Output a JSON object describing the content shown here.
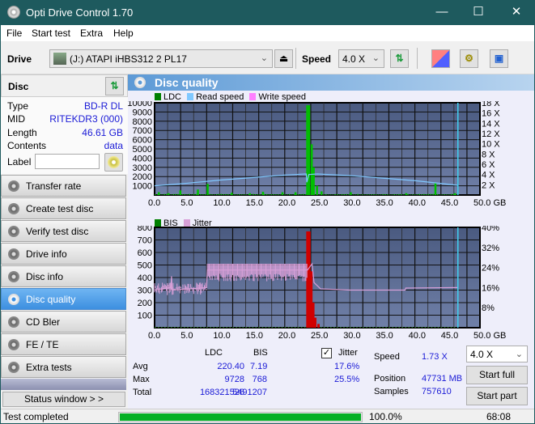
{
  "window": {
    "title": "Opti Drive Control 1.70",
    "minimize": "—",
    "maximize": "☐",
    "close": "✕"
  },
  "menu": [
    "File",
    "Start test",
    "Extra",
    "Help"
  ],
  "toolbar": {
    "drive_label": "Drive",
    "drive_value": "(J:)  ATAPI iHBS312   2 PL17",
    "eject": "⏏",
    "speed_label": "Speed",
    "speed_value": "4.0 X",
    "chevron": "⌄"
  },
  "disc": {
    "title": "Disc",
    "rows": [
      {
        "k": "Type",
        "v": "BD-R DL"
      },
      {
        "k": "MID",
        "v": "RITEKDR3 (000)"
      },
      {
        "k": "Length",
        "v": "46.61 GB"
      },
      {
        "k": "Contents",
        "v": "data"
      }
    ],
    "label_key": "Label",
    "label_value": ""
  },
  "nav": [
    {
      "label": "Transfer rate",
      "active": false
    },
    {
      "label": "Create test disc",
      "active": false
    },
    {
      "label": "Verify test disc",
      "active": false
    },
    {
      "label": "Drive info",
      "active": false
    },
    {
      "label": "Disc info",
      "active": false
    },
    {
      "label": "Disc quality",
      "active": true
    },
    {
      "label": "CD Bler",
      "active": false
    },
    {
      "label": "FE / TE",
      "active": false
    },
    {
      "label": "Extra tests",
      "active": false
    }
  ],
  "status_window": "Status window > >",
  "panel": {
    "title": "Disc quality"
  },
  "chart_data": [
    {
      "type": "bar",
      "title": "LDC / Read speed",
      "legend": [
        "LDC",
        "Read speed",
        "Write speed"
      ],
      "legend_colors": {
        "LDC": "#00c000",
        "Read speed": "#80c8ff",
        "Write speed": "#ff80ff"
      },
      "xlabel": "GB",
      "xlim": [
        0,
        50
      ],
      "x_ticks": [
        "0.0",
        "5.0",
        "10.0",
        "15.0",
        "20.0",
        "25.0",
        "30.0",
        "35.0",
        "40.0",
        "45.0",
        "50.0 GB"
      ],
      "ylim": [
        0,
        10000
      ],
      "y_ticks": [
        "1000",
        "2000",
        "3000",
        "4000",
        "5000",
        "6000",
        "7000",
        "8000",
        "9000",
        "10000"
      ],
      "y2lim": [
        0,
        18
      ],
      "y2_ticks": [
        "2 X",
        "4 X",
        "6 X",
        "8 X",
        "10 X",
        "12 X",
        "14 X",
        "16 X",
        "18 X"
      ],
      "ldc_spikes": [
        [
          0.5,
          300
        ],
        [
          2.0,
          200
        ],
        [
          3.8,
          500
        ],
        [
          6.5,
          600
        ],
        [
          8.0,
          1200
        ],
        [
          11.7,
          250
        ],
        [
          14.5,
          200
        ],
        [
          16.5,
          350
        ],
        [
          19.5,
          300
        ],
        [
          21.5,
          300
        ],
        [
          23.3,
          9728
        ],
        [
          23.6,
          9728
        ],
        [
          24.0,
          5500
        ],
        [
          24.3,
          3000
        ],
        [
          24.8,
          1000
        ],
        [
          25.5,
          400
        ],
        [
          30.0,
          300
        ],
        [
          38.5,
          200
        ],
        [
          43.0,
          1300
        ],
        [
          46.0,
          200
        ]
      ],
      "read_speed": [
        [
          0,
          1.8
        ],
        [
          5,
          2.3
        ],
        [
          10,
          2.9
        ],
        [
          15,
          3.4
        ],
        [
          20,
          3.9
        ],
        [
          23.3,
          4.1
        ],
        [
          23.4,
          2.5
        ],
        [
          23.7,
          4.0
        ],
        [
          25,
          4.1
        ],
        [
          30,
          3.8
        ],
        [
          35,
          3.3
        ],
        [
          40,
          2.8
        ],
        [
          46.6,
          1.9
        ]
      ],
      "end_marker_gb": 46.61
    },
    {
      "type": "bar",
      "title": "BIS / Jitter",
      "legend": [
        "BIS",
        "Jitter"
      ],
      "legend_colors": {
        "BIS": "#00c000",
        "Jitter": "#d8a0d8"
      },
      "xlabel": "GB",
      "xlim": [
        0,
        50
      ],
      "x_ticks": [
        "0.0",
        "5.0",
        "10.0",
        "15.0",
        "20.0",
        "25.0",
        "30.0",
        "35.0",
        "40.0",
        "45.0",
        "50.0 GB"
      ],
      "ylim": [
        0,
        800
      ],
      "y_ticks": [
        "100",
        "200",
        "300",
        "400",
        "500",
        "600",
        "700",
        "800"
      ],
      "y2lim": [
        0,
        40
      ],
      "y2_ticks": [
        "8%",
        "16%",
        "24%",
        "32%",
        "40%"
      ],
      "bis_spikes": [
        [
          23.3,
          768
        ],
        [
          23.6,
          768
        ],
        [
          23.9,
          450
        ],
        [
          24.2,
          200
        ],
        [
          24.5,
          80
        ],
        [
          25.0,
          30
        ]
      ],
      "jitter": [
        [
          0,
          15
        ],
        [
          2.5,
          16
        ],
        [
          2.6,
          20.5
        ],
        [
          2.7,
          15
        ],
        [
          8.0,
          16
        ],
        [
          8.1,
          23
        ],
        [
          23.5,
          23
        ],
        [
          24.2,
          25.5
        ],
        [
          24.5,
          18
        ],
        [
          25.5,
          15.5
        ],
        [
          30,
          15
        ],
        [
          38.5,
          15
        ],
        [
          38.6,
          15.8
        ],
        [
          46.6,
          16
        ]
      ],
      "end_marker_gb": 46.61
    }
  ],
  "stats": {
    "headers": [
      "LDC",
      "BIS"
    ],
    "rows": [
      {
        "label": "Avg",
        "ldc": "220.40",
        "bis": "7.19",
        "jitter": "17.6%"
      },
      {
        "label": "Max",
        "ldc": "9728",
        "bis": "768",
        "jitter": "25.5%"
      },
      {
        "label": "Total",
        "ldc": "168321526",
        "bis": "5491207",
        "jitter": ""
      }
    ],
    "jitter_label": "Jitter",
    "jitter_checked": true,
    "speed_label": "Speed",
    "speed_value": "1.73 X",
    "position_label": "Position",
    "position_value": "47731 MB",
    "samples_label": "Samples",
    "samples_value": "757610",
    "speed_select": "4.0 X",
    "start_full": "Start full",
    "start_part": "Start part"
  },
  "statusbar": {
    "text": "Test completed",
    "progress_percent": 100.0,
    "progress_label": "100.0%",
    "time": "68:08"
  }
}
